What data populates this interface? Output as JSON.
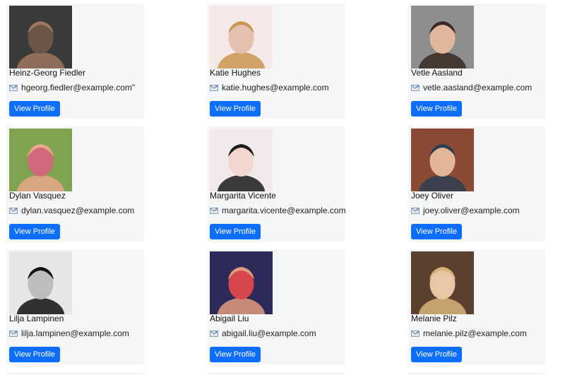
{
  "button_label": "View Profile",
  "accent_color": "#0d6efd",
  "users": [
    {
      "name": "Heinz-Georg Fiedler",
      "email": "hgeorg.fiedler@example.com\"",
      "avatar": "photo-man-beard-dark",
      "colors": [
        "#3b3a3a",
        "#a07660",
        "#6b5546"
      ]
    },
    {
      "name": "Katie Hughes",
      "email": "katie.hughes@example.com",
      "avatar": "photo-woman-blonde",
      "colors": [
        "#f4e9e6",
        "#c9954f",
        "#e3c0b0"
      ]
    },
    {
      "name": "Vetle Aasland",
      "email": "vetle.aasland@example.com",
      "avatar": "photo-man-suit",
      "colors": [
        "#8e8e8e",
        "#3a2a22",
        "#e0b79c"
      ]
    },
    {
      "name": "Dylan Vasquez",
      "email": "dylan.vasquez@example.com",
      "avatar": "photo-man-bald-beard",
      "colors": [
        "#7fa34f",
        "#e8a88a",
        "#d0697a"
      ]
    },
    {
      "name": "Margarita Vicente",
      "email": "margarita.vicente@example.com",
      "avatar": "photo-woman-short-hair",
      "colors": [
        "#f2eaea",
        "#1b1b1b",
        "#f1d7cd"
      ]
    },
    {
      "name": "Joey Oliver",
      "email": "joey.oliver@example.com",
      "avatar": "photo-man-brick-wall",
      "colors": [
        "#8a4a34",
        "#2e3d52",
        "#e3b597"
      ]
    },
    {
      "name": "Lilja Lampinen",
      "email": "lilja.lampinen@example.com",
      "avatar": "photo-woman-beanie-glasses",
      "colors": [
        "#e6e6e6",
        "#111111",
        "#bdbdbd"
      ]
    },
    {
      "name": "Abigail Liu",
      "email": "abigail.liu@example.com",
      "avatar": "photo-woman-smiling",
      "colors": [
        "#2d2a5a",
        "#e29b7c",
        "#d8464d"
      ]
    },
    {
      "name": "Melanie Pilz",
      "email": "melanie.pilz@example.com",
      "avatar": "photo-woman-long-blonde",
      "colors": [
        "#5b4030",
        "#d9b47a",
        "#e8c6a6"
      ]
    }
  ]
}
